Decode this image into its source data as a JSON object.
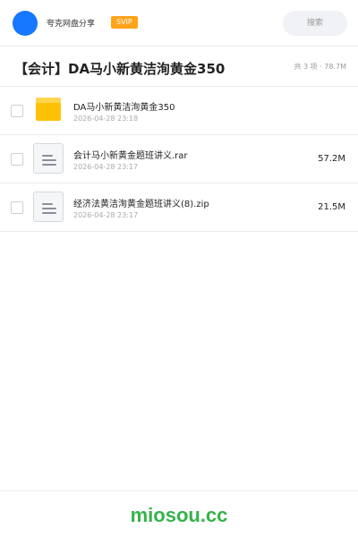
{
  "header": {
    "username": "夸克网盘分享",
    "badge": "SVIP",
    "search_placeholder": "搜索",
    "avatar_color": "#1677ff"
  },
  "share": {
    "title": "【会计】DA马小新黄洁洵黄金350",
    "meta": "共 3 项 · 78.7M"
  },
  "files": [
    {
      "type": "folder-icon",
      "name": "DA马小新黄洁洵黄金350",
      "date": "2026-04-28 23:18",
      "size": ""
    },
    {
      "type": "document-icon",
      "name": "会计马小新黄金题班讲义.rar",
      "date": "2026-04-28 23:17",
      "size": "57.2M"
    },
    {
      "type": "document-icon",
      "name": "经济法黄洁洵黄金题班讲义(8).zip",
      "date": "2026-04-28 23:17",
      "size": "21.5M"
    }
  ],
  "footer": {
    "brand": "miosou.cc",
    "brand_color": "#34b34a"
  },
  "colors": {
    "badge": "#ffa31a",
    "folder": "#ffc107"
  }
}
